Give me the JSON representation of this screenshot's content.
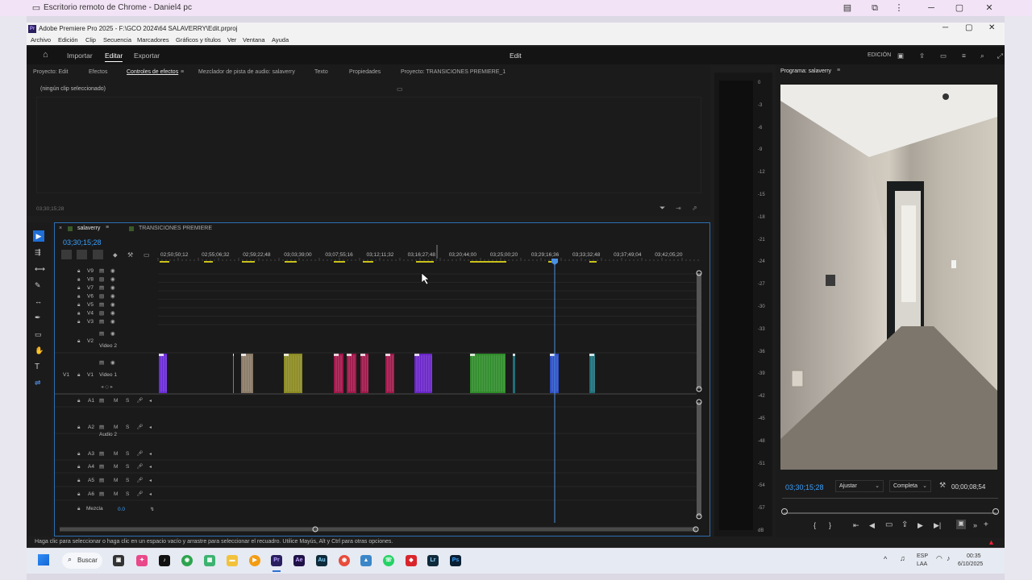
{
  "chrome": {
    "title": "Escritorio remoto de Chrome - Daniel4 pc"
  },
  "app": {
    "title": "Adobe Premiere Pro 2025 - F:\\GCO 2024\\64 SALAVERRY\\Edit.prproj"
  },
  "menu": [
    "Archivo",
    "Edición",
    "Clip",
    "Secuencia",
    "Marcadores",
    "Gráficos y títulos",
    "Ver",
    "Ventana",
    "Ayuda"
  ],
  "workspace": {
    "import": "Importar",
    "edit": "Editar",
    "export": "Exportar",
    "center": "Edit",
    "mode": "EDICIÓN"
  },
  "panel_tabs": [
    "Proyecto: Edit",
    "Efectos",
    "Controles de efectos",
    "Mezclador de pista de audio: salaverry",
    "Texto",
    "Propiedades",
    "Proyecto: TRANSICIONES PREMIERE_1"
  ],
  "effect_controls": {
    "empty": "(ningún clip seleccionado)",
    "timecode": "03;30;15;28"
  },
  "timeline": {
    "tab1": "salaverry",
    "tab2": "TRANSICIONES PREMIERE",
    "timecode": "03;30;15;28",
    "ruler": [
      "02;50;50;12",
      "02;55;06;32",
      "02;59;22;48",
      "03;03;39;00",
      "03;07;55;16",
      "03;12;11;32",
      "03;16;27;48",
      "03;20;44;00",
      "03;25;00;20",
      "03;29;16;36",
      "03;33;32;48",
      "03;37;49;04",
      "03;42;05;20"
    ],
    "video_tracks": [
      "V9",
      "V8",
      "V7",
      "V6",
      "V5",
      "V4",
      "V3",
      "V2",
      "V1"
    ],
    "video2_label": "Video 2",
    "video1_label": "Video 1",
    "v1_src": "V1",
    "audio_tracks": [
      "A1",
      "A2",
      "A3",
      "A4",
      "A5",
      "A6"
    ],
    "audio2_label": "Audio 2",
    "mix_label": "Mezcla",
    "mix_value": "0.0",
    "m_label": "M",
    "s_label": "S"
  },
  "meter": [
    "0",
    "-3",
    "-6",
    "-9",
    "-12",
    "-15",
    "-18",
    "-21",
    "-24",
    "-27",
    "-30",
    "-33",
    "-36",
    "-39",
    "-42",
    "-45",
    "-48",
    "-51",
    "-54",
    "-57",
    "dB"
  ],
  "program": {
    "title": "Programa: salaverry",
    "timecode": "03;30;15;28",
    "fit": "Ajustar",
    "quality": "Completa",
    "duration": "00;00;08;54"
  },
  "status": "Haga clic para seleccionar o haga clic en un espacio vacío y arrastre para seleccionar el recuadro. Utilice Mayús, Alt y Ctrl para otras opciones.",
  "taskbar": {
    "search": "Buscar",
    "lang1": "ESP",
    "lang2": "LAA",
    "time": "00:35",
    "date": "6/10/2025"
  },
  "colors": {
    "accent": "#2d8ceb",
    "playhead": "#4a90e2",
    "purple": "#6b2bd6",
    "tan": "#8a7a66",
    "olive": "#8b8a22",
    "crimson": "#a0174a",
    "violet": "#6a25c9",
    "green": "#2f8c2a",
    "blue": "#2e4fc4",
    "teal": "#1f6f7a"
  }
}
